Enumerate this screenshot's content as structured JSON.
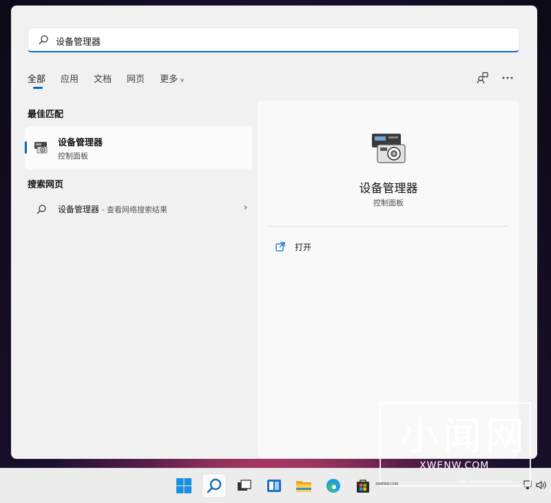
{
  "search": {
    "value": "设备管理器"
  },
  "tabs": [
    {
      "label": "全部"
    },
    {
      "label": "应用"
    },
    {
      "label": "文档"
    },
    {
      "label": "网页"
    },
    {
      "label": "更多"
    }
  ],
  "best_match": {
    "heading": "最佳匹配",
    "title": "设备管理器",
    "subtitle": "控制面板"
  },
  "web_search": {
    "heading": "搜索网页",
    "query": "设备管理器",
    "suffix": " - 查看网络搜索结果"
  },
  "detail": {
    "title": "设备管理器",
    "subtitle": "控制面板",
    "actions": [
      {
        "label": "打开"
      }
    ]
  },
  "watermark": {
    "big_text": "小闻网",
    "domain": "XWENW.COM",
    "side_text": "XWENW.COM",
    "bottom_text": "小闻网（WWW.XWENW.COM)专用",
    "bottom_left": "XWENW.COM"
  },
  "colors": {
    "accent": "#0067c0"
  }
}
